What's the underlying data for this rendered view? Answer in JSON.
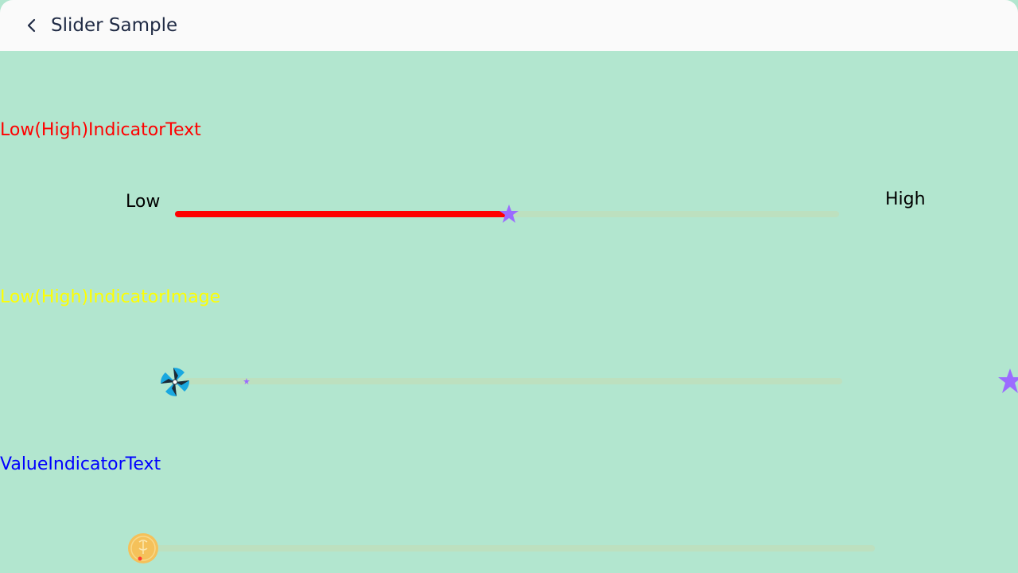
{
  "header": {
    "title": "Slider Sample",
    "back_icon": "chevron-left-icon"
  },
  "sections": [
    {
      "label": "Low(High)IndicatorText",
      "label_color": "#ff0000",
      "low_indicator_text": "Low",
      "high_indicator_text": "High",
      "value_fraction": 0.5,
      "fill_color": "#ff0000",
      "thumb_icon": "purple-star-icon"
    },
    {
      "label": "Low(High)IndicatorImage",
      "label_color": "#ffff00",
      "low_indicator_icon": "pinwheel-icon",
      "high_indicator_icon": "purple-star-icon",
      "value_fraction": 0.1
    },
    {
      "label": "ValueIndicatorText",
      "label_color": "#0000ff",
      "thumb_icon": "coin-icon",
      "value_fraction": 0.0
    }
  ]
}
